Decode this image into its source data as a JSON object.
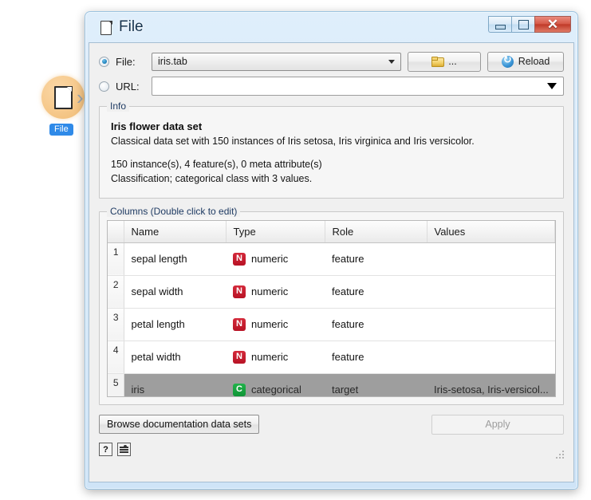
{
  "canvas": {
    "widget_icon": "document-icon",
    "widget_label": "File"
  },
  "window": {
    "title": "File",
    "title_icon": "document-icon",
    "minimize_label": "",
    "maximize_label": "",
    "close_label": "✕"
  },
  "source": {
    "file_radio_label": "File:",
    "file_radio_selected": true,
    "file_value": "iris.tab",
    "url_radio_label": "URL:",
    "url_radio_selected": false,
    "url_value": "",
    "browse_label": "...",
    "browse_icon": "folder-icon",
    "reload_label": "Reload",
    "reload_icon": "reload-icon"
  },
  "info": {
    "group_title": "Info",
    "title": "Iris flower data set",
    "description": "Classical data set with 150 instances of Iris setosa, Iris virginica and Iris versicolor.",
    "stats": "150 instance(s), 4 feature(s), 0 meta attribute(s)",
    "task": "Classification; categorical class with 3 values."
  },
  "columns": {
    "group_title": "Columns (Double click to edit)",
    "headers": [
      "",
      "Name",
      "Type",
      "Role",
      "Values"
    ],
    "rows": [
      {
        "index": "1",
        "name": "sepal length",
        "type": "numeric",
        "type_badge": "N",
        "type_kind": "numeric",
        "role": "feature",
        "values": "",
        "selected": false
      },
      {
        "index": "2",
        "name": "sepal width",
        "type": "numeric",
        "type_badge": "N",
        "type_kind": "numeric",
        "role": "feature",
        "values": "",
        "selected": false
      },
      {
        "index": "3",
        "name": "petal length",
        "type": "numeric",
        "type_badge": "N",
        "type_kind": "numeric",
        "role": "feature",
        "values": "",
        "selected": false
      },
      {
        "index": "4",
        "name": "petal width",
        "type": "numeric",
        "type_badge": "N",
        "type_kind": "numeric",
        "role": "feature",
        "values": "",
        "selected": false
      },
      {
        "index": "5",
        "name": "iris",
        "type": "categorical",
        "type_badge": "C",
        "type_kind": "categorical",
        "role": "target",
        "values": "Iris-setosa, Iris-versicol...",
        "selected": true
      }
    ]
  },
  "footer": {
    "browse_docs_label": "Browse documentation data sets",
    "apply_label": "Apply",
    "apply_enabled": false,
    "help_label": "?",
    "report_icon": "report-icon"
  },
  "colors": {
    "accent_blue": "#2f8ae8",
    "numeric_badge": "#c4192a",
    "categorical_badge": "#16a43c",
    "selection_gray": "#9e9e9e",
    "widget_orange": "#f3c68a"
  }
}
